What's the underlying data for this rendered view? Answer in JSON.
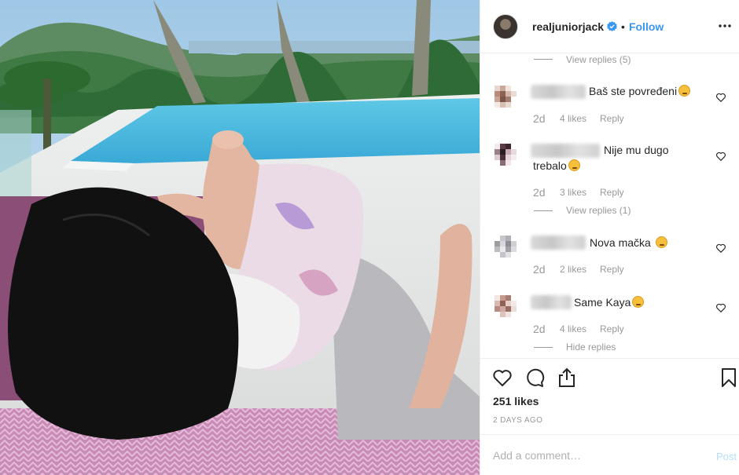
{
  "post": {
    "photo_icon": "vacation-photo",
    "username": "realjuniorjack",
    "separator": "•",
    "follow_label": "Follow",
    "more_icon": "more-options-icon"
  },
  "comments": {
    "view_replies_top": "View replies (5)",
    "items": [
      {
        "text": "Baš ste povređeni",
        "time": "2d",
        "likes": "4 likes",
        "reply": "Reply"
      },
      {
        "text_line1": "Nije mu dugo",
        "text_line2": "trebalo",
        "time": "2d",
        "likes": "3 likes",
        "reply": "Reply",
        "view_replies": "View replies (1)"
      },
      {
        "text": "Nova mačka",
        "time": "2d",
        "likes": "2 likes",
        "reply": "Reply"
      },
      {
        "text": "Same Kaya",
        "time": "2d",
        "likes": "4 likes",
        "reply": "Reply",
        "hide_replies": "Hide replies"
      }
    ]
  },
  "footer": {
    "likes": "251 likes",
    "timestamp": "2 DAYS AGO",
    "add_comment_placeholder": "Add a comment…",
    "post_label": "Post"
  },
  "colors": {
    "accent": "#3897f0",
    "muted": "#999999",
    "border": "#efefef"
  }
}
